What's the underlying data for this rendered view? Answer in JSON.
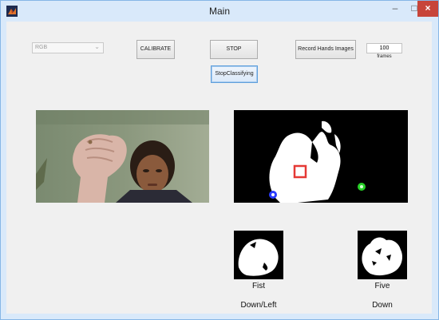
{
  "window": {
    "title": "Main",
    "minimize_glyph": "–",
    "maximize_glyph": "□",
    "close_glyph": "×"
  },
  "toolbar": {
    "color_mode": "RGB",
    "calibrate_label": "CALIBRATE",
    "stop_label": "STOP",
    "stop_classifying_label": "StopClassifying",
    "record_label": "Record Hands Images",
    "frames_value": "100",
    "frames_label": "frames"
  },
  "results": {
    "left_gesture": "Fist",
    "left_direction": "Down/Left",
    "right_gesture": "Five",
    "right_direction": "Down"
  },
  "colors": {
    "titlebar": "#d9e9fa",
    "close_button": "#c7453a",
    "marker_red": "#e53935",
    "marker_blue": "#2a3cff",
    "marker_green": "#27d027"
  }
}
